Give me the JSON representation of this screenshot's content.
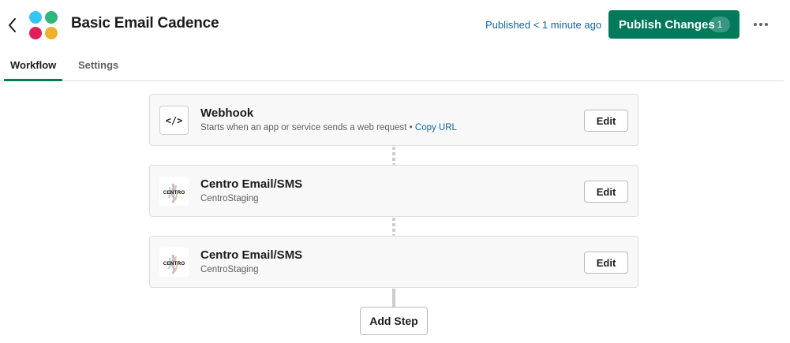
{
  "header": {
    "title": "Basic Email Cadence",
    "published_status": "Published < 1 minute ago",
    "publish_label": "Publish Changes",
    "publish_count": "1",
    "icons": {
      "back": "chevron-left-icon",
      "more": "ellipsis-icon",
      "logo": "slack-logo"
    }
  },
  "tabs": [
    {
      "label": "Workflow",
      "active": true
    },
    {
      "label": "Settings",
      "active": false
    }
  ],
  "steps": [
    {
      "title": "Webhook",
      "subtitle": "Starts when an app or service sends a web request",
      "separator": "•",
      "link": "Copy URL",
      "icon": "code-icon",
      "edit_label": "Edit"
    },
    {
      "title": "Centro Email/SMS",
      "subtitle": "CentroStaging",
      "icon_text": "CENTRO",
      "icon": "centro-logo",
      "edit_label": "Edit"
    },
    {
      "title": "Centro Email/SMS",
      "subtitle": "CentroStaging",
      "icon_text": "CENTRO",
      "icon": "centro-logo",
      "edit_label": "Edit"
    }
  ],
  "add_step_label": "Add Step",
  "colors": {
    "primary_green": "#007a5a",
    "link_blue": "#1264a3",
    "card_bg": "#f8f8f8",
    "border": "#dddddd"
  }
}
